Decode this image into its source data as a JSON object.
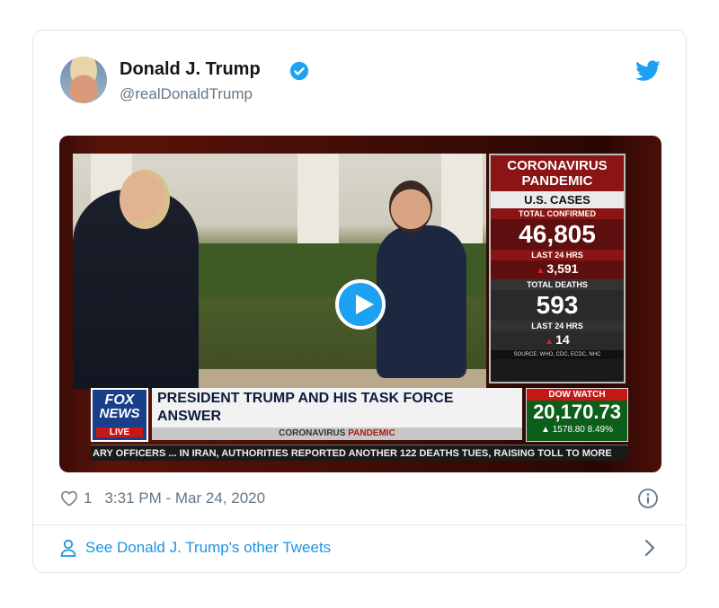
{
  "tweet": {
    "author_name": "Donald J. Trump",
    "author_handle": "@realDonaldTrump",
    "likes": "1",
    "timestamp": "3:31 PM - Mar 24, 2020",
    "see_more": "See Donald J. Trump's other Tweets"
  },
  "video": {
    "panel": {
      "title_line1": "CORONAVIRUS",
      "title_line2": "PANDEMIC",
      "subtitle": "U.S. CASES",
      "confirmed_label": "TOTAL CONFIRMED",
      "confirmed_value": "46,805",
      "confirmed_24_label": "LAST 24 HRS",
      "confirmed_24_value": "3,591",
      "deaths_label": "TOTAL DEATHS",
      "deaths_value": "593",
      "deaths_24_label": "LAST 24 HRS",
      "deaths_24_value": "14",
      "source": "SOURCE: WHO, CDC, ECDC, NHC"
    },
    "logo": {
      "line1": "FOX",
      "line2": "NEWS",
      "line3": "LIVE"
    },
    "headline_line1": "PRESIDENT TRUMP AND HIS TASK FORCE ANSWER",
    "headline_line2": "YOUR QUESTIONS ON CORONAVIRUS PANDEMIC",
    "subbar_prefix": "CORONAVIRUS",
    "subbar_accent": "PANDEMIC",
    "dow_title": "DOW WATCH",
    "dow_value": "20,170.73",
    "dow_change": "1578.80 8.49%",
    "ticker": "ARY OFFICERS ...   IN IRAN, AUTHORITIES REPORTED ANOTHER 122 DEATHS TUES, RAISING TOLL TO MORE"
  },
  "colors": {
    "link": "#1b95e0",
    "twitter_blue": "#1da1f2",
    "muted": "#657786"
  },
  "icons": [
    "verified-badge-icon",
    "twitter-bird-icon",
    "play-icon",
    "heart-icon",
    "info-icon",
    "user-icon",
    "chevron-right-icon"
  ]
}
